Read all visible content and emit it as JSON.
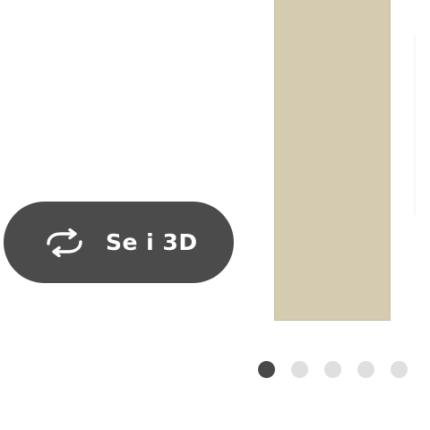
{
  "view_3d_button": {
    "label": "Se i 3D",
    "icon": "rotate-icon"
  },
  "gallery": {
    "total_images": 5,
    "active_index": 0
  },
  "colors": {
    "button_background": "#4b4b4b",
    "product_color": "#d5cbb1",
    "dot_active": "#484848",
    "dot_inactive": "#dfdfdf"
  }
}
